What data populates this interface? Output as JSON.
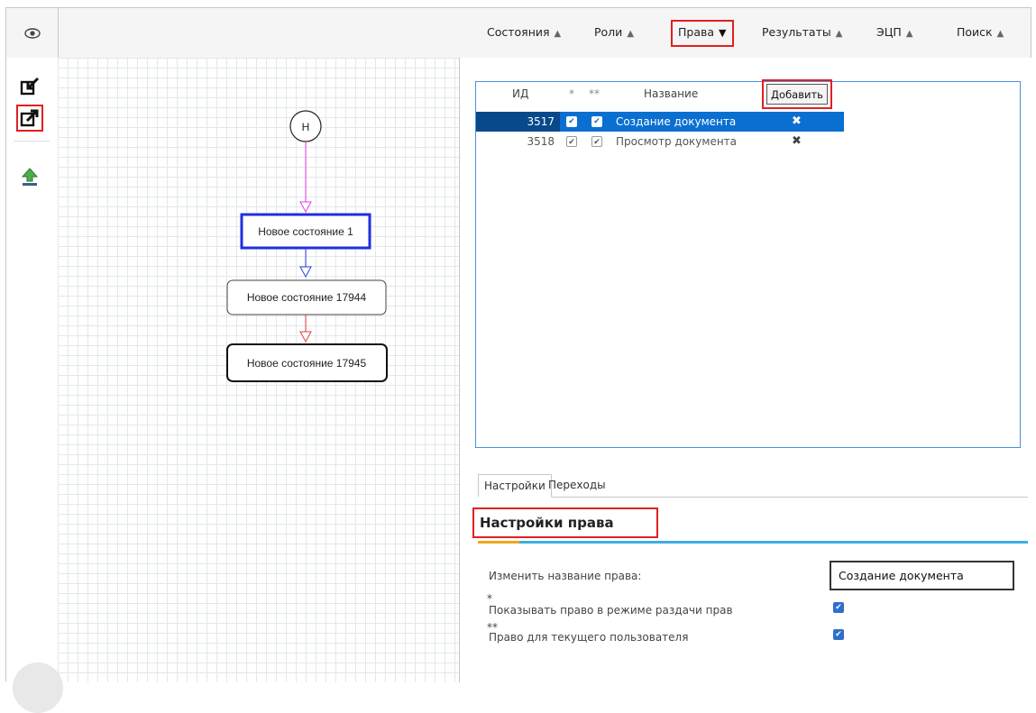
{
  "topbar": {
    "eye_icon": "eye-icon",
    "menu": [
      {
        "label": "Состояния",
        "chevron": "up"
      },
      {
        "label": "Роли",
        "chevron": "up"
      },
      {
        "label": "Права",
        "chevron": "down"
      },
      {
        "label": "Результаты",
        "chevron": "up"
      },
      {
        "label": "ЭЦП",
        "chevron": "up"
      },
      {
        "label": "Поиск",
        "chevron": "up"
      }
    ]
  },
  "toolbar": {
    "tools": [
      "import-icon",
      "export-icon",
      "upload-icon"
    ]
  },
  "diagram": {
    "start_label": "Н",
    "states": [
      "Новое состояние 1",
      "Новое состояние 17944",
      "Новое состояние 17945"
    ]
  },
  "rights_grid": {
    "headers": {
      "id": "ИД",
      "star1": "*",
      "star2": "**",
      "name": "Название"
    },
    "add_label": "Добавить",
    "rows": [
      {
        "id": "3517",
        "c1": true,
        "c2": true,
        "name": "Создание документа",
        "selected": true
      },
      {
        "id": "3518",
        "c1": true,
        "c2": true,
        "name": "Просмотр документа",
        "selected": false
      }
    ]
  },
  "tabs": [
    "Настройки",
    "Переходы"
  ],
  "settings": {
    "title": "Настройки права",
    "rename_label": "Изменить название права:",
    "rename_value": "Создание документа",
    "opt1_mark": "*",
    "opt1_label": "Показывать право в режиме раздачи прав",
    "opt1_checked": true,
    "opt2_mark": "**",
    "opt2_label": "Право для текущего пользователя",
    "opt2_checked": true
  },
  "colors": {
    "highlight": "#e21f1f",
    "selection": "#0a6fd0",
    "accent_line": "#3cb0df",
    "state_border_selected": "#1f2fe0"
  }
}
